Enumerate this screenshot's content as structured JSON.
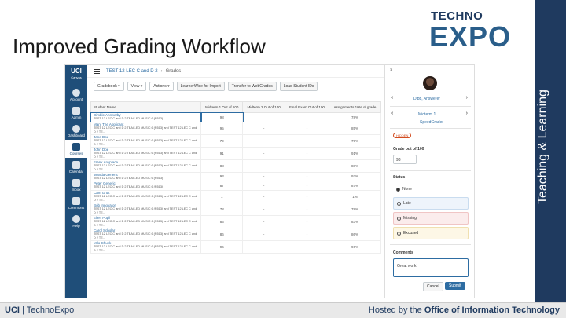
{
  "slide": {
    "title": "Improved Grading Workflow",
    "logo_top": "TECHNO",
    "logo_main": "EXPO",
    "side_text": "Teaching & Learning"
  },
  "footer": {
    "left_bold": "UCI",
    "left_rest": " | TechnoExpo",
    "right_pre": "Hosted by the ",
    "right_bold": "Office of Information Technology"
  },
  "canvas": {
    "brand": "UCI",
    "brand_sub": "Canvas",
    "nav": [
      {
        "label": "Account"
      },
      {
        "label": "Admin"
      },
      {
        "label": "Dashboard"
      },
      {
        "label": "Courses"
      },
      {
        "label": "Calendar"
      },
      {
        "label": "Inbox"
      },
      {
        "label": "Commons"
      },
      {
        "label": "Help"
      }
    ],
    "breadcrumb": {
      "course": "TEST 12 LEC C and D 2",
      "separator": "›",
      "current": "Grades"
    },
    "toolbar": {
      "gradebook": "Gradebook ▾",
      "view": "View ▾",
      "actions": "Actions ▾",
      "btn1": "LearnerWise for Import",
      "btn2": "Transfer to WebGrades",
      "btn3": "Load Student IDs"
    },
    "columns": [
      "Student Name",
      "Midterm 1 Out of 100",
      "Midterm 2 Out of 100",
      "Final Exam Out of 100",
      "Assignments 10% of grade"
    ],
    "rows": [
      {
        "name": "Dimble Answerby",
        "section": "TEST 12 LEC C and D 2 TEAC-ED MUSIC 6 (R513)",
        "m1": "98",
        "m2": "",
        "fe": "",
        "as": "78%"
      },
      {
        "name": "Mary The Applicant",
        "section": "TEST 12 LEC C and D 2 TEAC-ED MUSIC 6 (R513) and TEST 12 LEC C and D 2 TE...",
        "m1": "95",
        "m2": "-",
        "fe": "-",
        "as": "85%"
      },
      {
        "name": "Jane Doe",
        "section": "TEST 12 LEC C and D 2 TEAC-ED MUSIC 6 (R513) and TEST 12 LEC C and D 2 TE...",
        "m1": "79",
        "m2": "-",
        "fe": "-",
        "as": "79%"
      },
      {
        "name": "John Doe",
        "section": "TEST 12 LEC C and D 2 TEAC-ED MUSIC 6 (R513) and TEST 12 LEC C and D 2 TE...",
        "m1": "91",
        "m2": "-",
        "fe": "-",
        "as": "91%"
      },
      {
        "name": "Frank Anyplace",
        "section": "TEST 12 LEC C and D 2 TEAC-ED MUSIC 6 (R513) and TEST 12 LEC C and D 2 TE...",
        "m1": "88",
        "m2": "-",
        "fe": "-",
        "as": "88%"
      },
      {
        "name": "Wanda Generic",
        "section": "TEST 12 LEC C and D 2 TEAC-ED MUSIC 6 (R513)",
        "m1": "93",
        "m2": "-",
        "fe": "-",
        "as": "93%"
      },
      {
        "name": "Peter Generic",
        "section": "TEST 12 LEC C and D 2 TEAC-ED MUSIC 6 (R513)",
        "m1": "87",
        "m2": "-",
        "fe": "-",
        "as": "87%"
      },
      {
        "name": "Cam Gnat",
        "section": "TEST 12 LEC C and D 2 TEAC-ED MUSIC 6 (R513) and TEST 12 LEC C and D 2 TE...",
        "m1": "1",
        "m2": "-",
        "fe": "-",
        "as": "1%"
      },
      {
        "name": "Bob Innovator",
        "section": "TEST 12 LEC C and D 2 TEAC-ED MUSIC 6 (R513) and TEST 12 LEC C and D 2 TE...",
        "m1": "78",
        "m2": "-",
        "fe": "-",
        "as": "78%"
      },
      {
        "name": "Ellen Pupil",
        "section": "TEST 12 LEC C and D 2 TEAC-ED MUSIC 6 (R513) and TEST 12 LEC C and D 2 TE...",
        "m1": "83",
        "m2": "-",
        "fe": "-",
        "as": "83%"
      },
      {
        "name": "Carol Scholar",
        "section": "TEST 12 LEC C and D 2 TEAC-ED MUSIC 6 (R513) and TEST 12 LEC C and D 2 TE...",
        "m1": "86",
        "m2": "-",
        "fe": "-",
        "as": "86%"
      },
      {
        "name": "Milo Chuck",
        "section": "TEST 12 LEC C and D 2 TEAC-ED MUSIC 6 (R513) and TEST 12 LEC C and D 2 TE...",
        "m1": "96",
        "m2": "-",
        "fe": "-",
        "as": "96%"
      }
    ],
    "panel": {
      "close": "×",
      "student": "Dibb, Answerer",
      "assignment": "Midterm 1",
      "speedgrader": "SpeedGrader",
      "hidden": "HIDDEN",
      "grade_label": "Grade out of 100",
      "grade_value": "98",
      "status_label": "Status",
      "status_options": [
        "None",
        "Late",
        "Missing",
        "Excused"
      ],
      "comments_label": "Comments",
      "comment_text": "Great work!",
      "cancel": "Cancel",
      "submit": "Submit"
    }
  }
}
